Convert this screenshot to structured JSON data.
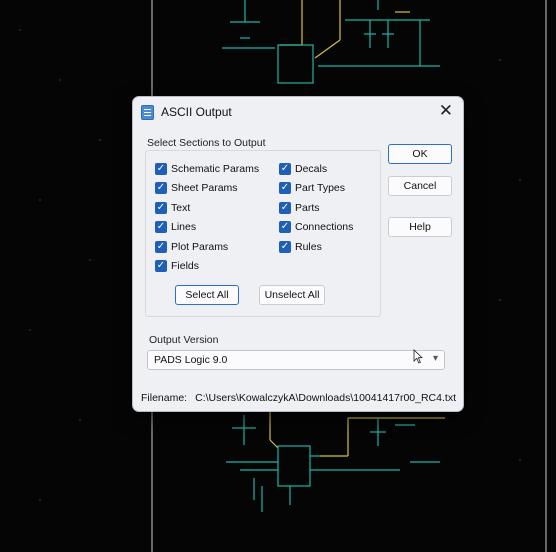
{
  "dialog": {
    "title": "ASCII Output",
    "close_glyph": "✕",
    "sections_label": "Select Sections to Output",
    "checkboxes_left": [
      {
        "label": "Schematic Params",
        "checked": true
      },
      {
        "label": "Sheet Params",
        "checked": true
      },
      {
        "label": "Text",
        "checked": true
      },
      {
        "label": "Lines",
        "checked": true
      },
      {
        "label": "Plot Params",
        "checked": true
      },
      {
        "label": "Fields",
        "checked": true
      }
    ],
    "checkboxes_right": [
      {
        "label": "Decals",
        "checked": true
      },
      {
        "label": "Part Types",
        "checked": true
      },
      {
        "label": "Parts",
        "checked": true
      },
      {
        "label": "Connections",
        "checked": true
      },
      {
        "label": "Rules",
        "checked": true
      }
    ],
    "select_all_label": "Select All",
    "unselect_all_label": "Unselect All",
    "ok_label": "OK",
    "cancel_label": "Cancel",
    "help_label": "Help",
    "output_version_label": "Output Version",
    "output_version_value": "PADS Logic 9.0",
    "filename_label": "Filename:",
    "filename_value": "C:\\Users\\KowalczykA\\Downloads\\10041417r00_RC4.txt"
  },
  "colors": {
    "background": "#050505",
    "trace_yellow": "#d8c23a",
    "wire_teal": "#1fb3a6",
    "checkbox_blue": "#1f5fb8",
    "dialog_bg": "#eef0f4"
  }
}
